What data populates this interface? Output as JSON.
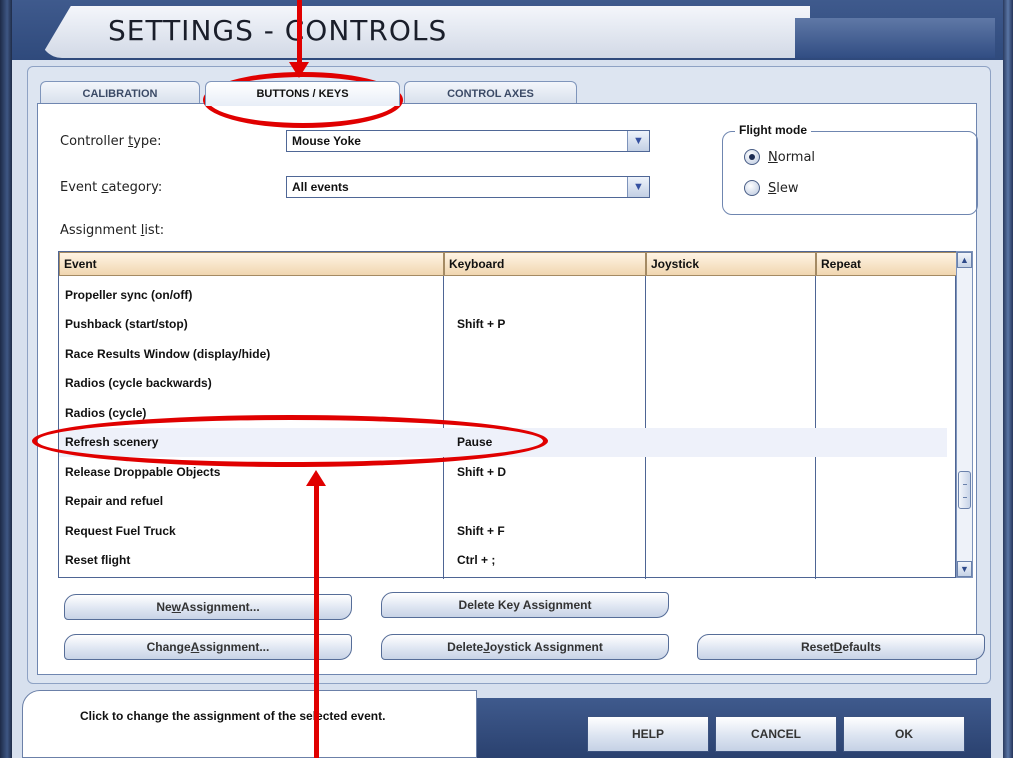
{
  "window": {
    "title": "SETTINGS - CONTROLS"
  },
  "tabs": [
    {
      "label": "CALIBRATION",
      "active": false
    },
    {
      "label": "BUTTONS / KEYS",
      "active": true
    },
    {
      "label": "CONTROL AXES",
      "active": false
    }
  ],
  "form": {
    "controller_type_label_pre": "Controller ",
    "controller_type_label_u": "t",
    "controller_type_label_post": "ype:",
    "controller_type_value": "Mouse Yoke",
    "event_category_label_pre": "Event ",
    "event_category_label_u": "c",
    "event_category_label_post": "ategory:",
    "event_category_value": "All events",
    "assignment_list_label_pre": "Assignment ",
    "assignment_list_label_u": "l",
    "assignment_list_label_post": "ist:"
  },
  "flight_mode": {
    "legend": "Flight mode",
    "options": [
      {
        "u": "N",
        "rest": "ormal",
        "selected": true
      },
      {
        "u": "S",
        "rest": "lew",
        "selected": false
      }
    ]
  },
  "table": {
    "columns": [
      "Event",
      "Keyboard",
      "Joystick",
      "Repeat"
    ],
    "rows": [
      {
        "event": "Propeller sync (on/off)",
        "keyboard": "",
        "joystick": "",
        "repeat": ""
      },
      {
        "event": "Pushback (start/stop)",
        "keyboard": "Shift + P",
        "joystick": "",
        "repeat": ""
      },
      {
        "event": "Race Results Window (display/hide)",
        "keyboard": "",
        "joystick": "",
        "repeat": ""
      },
      {
        "event": "Radios (cycle backwards)",
        "keyboard": "",
        "joystick": "",
        "repeat": ""
      },
      {
        "event": "Radios (cycle)",
        "keyboard": "",
        "joystick": "",
        "repeat": ""
      },
      {
        "event": "Refresh scenery",
        "keyboard": "Pause",
        "joystick": "",
        "repeat": "",
        "selected": true
      },
      {
        "event": "Release Droppable Objects",
        "keyboard": "Shift + D",
        "joystick": "",
        "repeat": ""
      },
      {
        "event": "Repair and refuel",
        "keyboard": "",
        "joystick": "",
        "repeat": ""
      },
      {
        "event": "Request Fuel Truck",
        "keyboard": "Shift + F",
        "joystick": "",
        "repeat": ""
      },
      {
        "event": "Reset flight",
        "keyboard": "Ctrl + ;",
        "joystick": "",
        "repeat": ""
      }
    ]
  },
  "actions": {
    "new_pre": "Ne",
    "new_u": "w",
    "new_post": " Assignment...",
    "delete_key": "Delete Key Assignment",
    "change_pre": "Change ",
    "change_u": "A",
    "change_post": "ssignment...",
    "delete_joy_pre": "Delete ",
    "delete_joy_u": "J",
    "delete_joy_post": "oystick Assignment",
    "reset_pre": "Reset ",
    "reset_u": "D",
    "reset_post": "efaults"
  },
  "status": {
    "text": "Click to change the assignment of the selected event."
  },
  "footer": {
    "help": "HELP",
    "cancel": "CANCEL",
    "ok": "OK"
  },
  "colors": {
    "annotation": "#e00000",
    "header_bg": "#f0d6b0",
    "frame": "#2f4a7c"
  }
}
